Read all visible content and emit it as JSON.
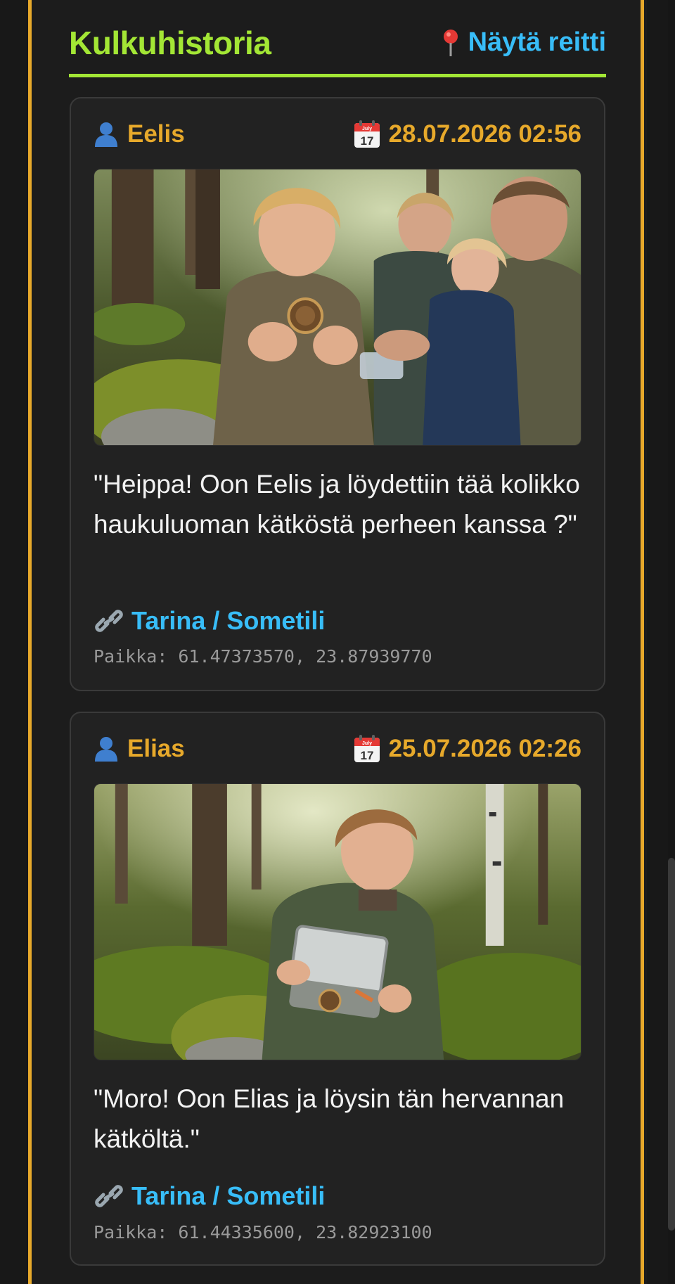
{
  "header": {
    "title": "Kulkuhistoria",
    "route_link": "Näytä reitti",
    "route_icon": "map-pin-icon"
  },
  "colors": {
    "accent_green": "#a3e635",
    "accent_yellow": "#e7a92b",
    "link_blue": "#38bdf8"
  },
  "entries": [
    {
      "user": "Eelis",
      "date": "28.07.2026 02:56",
      "photo": "family-forest-geocoin-photo",
      "quote": "\"Heippa! Oon Eelis ja löydettiin tää kolikko haukuluoman kätköstä perheen kanssa ?\"",
      "story_link": "Tarina / Sometili",
      "location": "Paikka: 61.47373570, 23.87939770"
    },
    {
      "user": "Elias",
      "date": "25.07.2026 02:26",
      "photo": "boy-forest-geocache-tin-photo",
      "quote": "\"Moro! Oon Elias ja löysin tän hervannan kätköltä.\"",
      "story_link": "Tarina / Sometili",
      "location": "Paikka: 61.44335600, 23.82923100"
    }
  ],
  "calendar_icon_label": "July",
  "calendar_icon_day": "17"
}
